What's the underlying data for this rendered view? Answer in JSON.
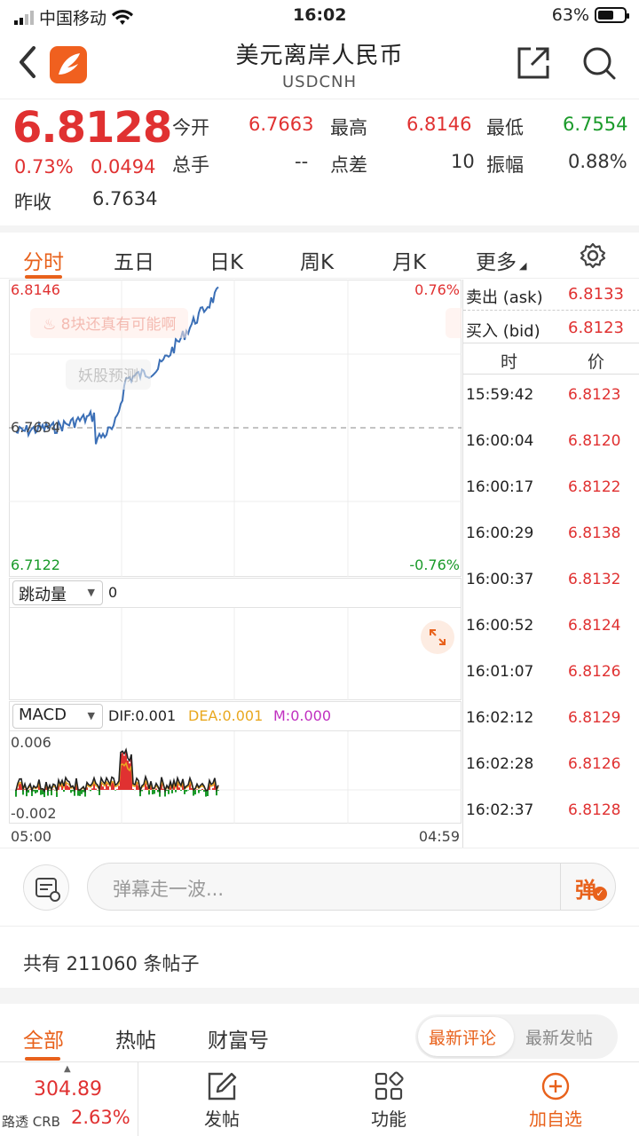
{
  "status_bar": {
    "carrier": "中国移动",
    "time": "16:02",
    "battery": "63%"
  },
  "header": {
    "title": "美元离岸人民币",
    "subtitle": "USDCNH"
  },
  "quote": {
    "price": "6.8128",
    "change_pct": "0.73%",
    "change": "0.0494",
    "prev_close_label": "昨收",
    "prev_close": "6.7634",
    "open_label": "今开",
    "open": "6.7663",
    "high_label": "最高",
    "high": "6.8146",
    "low_label": "最低",
    "low": "6.7554",
    "volume_label": "总手",
    "volume": "--",
    "spread_label": "点差",
    "spread": "10",
    "amplitude_label": "振幅",
    "amplitude": "0.88%"
  },
  "period_tabs": [
    "分时",
    "五日",
    "日K",
    "周K",
    "月K",
    "更多"
  ],
  "chart": {
    "top_left": "6.8146",
    "top_right": "0.76%",
    "mid_left": "6.7634",
    "bottom_left": "6.7122",
    "bottom_right": "-0.76%",
    "watermark1": "8块还真有可能啊",
    "watermark2": "妖股预测",
    "volume_select": "跳动量",
    "volume_value": "0",
    "macd_select": "MACD",
    "dif": "DIF:0.001",
    "dea": "DEA:0.001",
    "m": "M:0.000",
    "macd_top": "0.006",
    "macd_bottom": "-0.002",
    "x_start": "05:00",
    "x_end": "04:59",
    "colors": {
      "line": "#3b6fb6",
      "up": "#e03131",
      "down": "#1a9a2a",
      "dif": "#222222",
      "dea": "#e9a820",
      "m": "#c030c0"
    }
  },
  "orderbook": {
    "ask_label": "卖出 (ask)",
    "ask": "6.8133",
    "bid_label": "买入 (bid)",
    "bid": "6.8123",
    "col_time": "时",
    "col_price": "价",
    "ticks": [
      {
        "time": "15:59:42",
        "price": "6.8123"
      },
      {
        "time": "16:00:04",
        "price": "6.8120"
      },
      {
        "time": "16:00:17",
        "price": "6.8122"
      },
      {
        "time": "16:00:29",
        "price": "6.8138"
      },
      {
        "time": "16:00:37",
        "price": "6.8132"
      },
      {
        "time": "16:00:52",
        "price": "6.8124"
      },
      {
        "time": "16:01:07",
        "price": "6.8126"
      },
      {
        "time": "16:02:12",
        "price": "6.8129"
      },
      {
        "time": "16:02:28",
        "price": "6.8126"
      },
      {
        "time": "16:02:37",
        "price": "6.8128"
      }
    ]
  },
  "danmu": {
    "placeholder": "弹幕走一波...",
    "button": "弹"
  },
  "posts": {
    "count_text": "共有 211060 条帖子"
  },
  "feed_tabs": [
    "全部",
    "热帖",
    "财富号"
  ],
  "sort_options": [
    "最新评论",
    "最新发帖"
  ],
  "bottom_bar": {
    "index_value": "304.89",
    "index_name": "路透 CRB",
    "index_change": "2.63%",
    "post": "发帖",
    "functions": "功能",
    "add_watch": "加自选"
  }
}
